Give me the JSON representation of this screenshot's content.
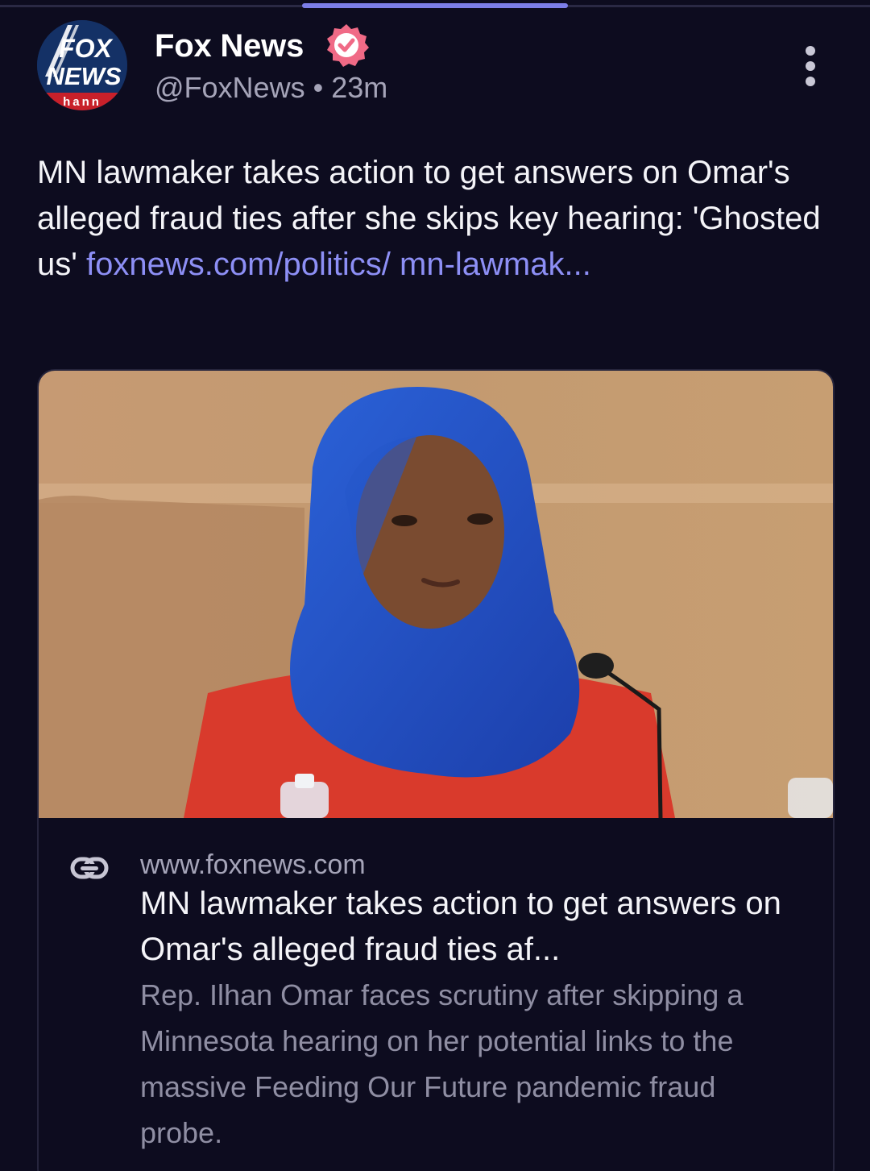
{
  "post": {
    "author_name": "Fox News",
    "author_handle": "@FoxNews",
    "separator": "•",
    "time_ago": "23m",
    "text": "MN lawmaker takes action to get answers on Omar's alleged fraud ties after she skips key hearing: 'Ghosted us' ",
    "link_text": "foxnews.com/politics/ mn-lawmak..."
  },
  "avatar": {
    "logo_line1": "FOX",
    "logo_line2": "NEWS",
    "logo_line3": "hann"
  },
  "icons": {
    "verified": "verified-badge-icon",
    "more": "more-vertical-icon",
    "link": "link-icon"
  },
  "link_card": {
    "domain": "www.foxnews.com",
    "title": "MN lawmaker takes action to get answers on Omar's alleged fraud ties af...",
    "description": "Rep. Ilhan Omar faces scrutiny after skipping a Minnesota hearing on her potential links to the massive Feeding Our Future pandemic fraud probe."
  },
  "colors": {
    "background": "#0d0c1f",
    "link": "#8d8ff5",
    "verified_badge": "#f06a86",
    "tab_indicator": "#7c7ee8"
  }
}
